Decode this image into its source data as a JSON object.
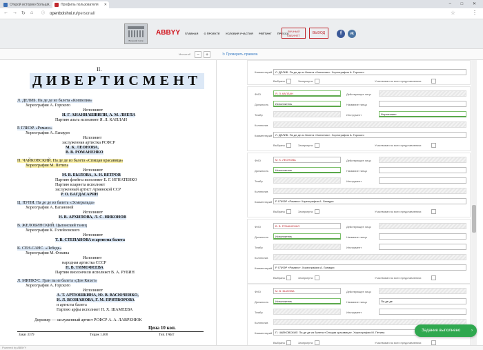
{
  "browser": {
    "tabs": [
      {
        "title": "Открой историю Больш…",
        "favicon_color": "#3b6fb5"
      },
      {
        "title": "Профиль пользователя",
        "favicon_color": "#c0272d"
      }
    ],
    "url_host": "openbolshoi.ru",
    "url_path": "/personal/",
    "window_controls": "–  □  ✕"
  },
  "header": {
    "bolshoi_caption": "Большой театр",
    "abbyy": "ABBYY",
    "nav": [
      "ГЛАВНАЯ",
      "О ПРОЕКТЕ",
      "УСЛОВИЯ УЧАСТИЯ",
      "РЕЙТИНГ",
      "ПРЕССА"
    ],
    "cabinet_line1": "ЛИЧНЫЙ",
    "cabinet_line2": "КАБИНЕТ",
    "exit": "ВЫХОД",
    "fb": "f",
    "vk": "vk"
  },
  "toolbar": {
    "zoom_label": "Масштаб",
    "zoom_out": "−",
    "zoom_in": "+",
    "check_rules": "Проверить правила"
  },
  "scan": {
    "roman": "II.",
    "title": "ДИВЕРТИСМЕНТ",
    "lines": [
      "Л. ДЕЛИБ. Па де де из балета «Коппелия»",
      "Хореография А. Горского",
      "Исполняют",
      "Н. Г. АНАНИАШВИЛИ, А. М. ЛИЕПА",
      "Партию альта исполняет Я. Л. КАПЛАН",
      "Р. ГЛИЭР. «Романс»",
      "Хореография А. Лапаури",
      "Исполняет",
      "заслуженная артистка РСФСР",
      "М. К. ЛЕОНОВА,",
      "В. В. РОМАНЕНКО",
      "П. ЧАЙКОВСКИЙ. Па де де из балета «Спящая красавица»",
      "Хореография М. Петипа",
      "Исполняют",
      "М. В. БЫЛОВА, А. Н. ВЕТРОВ",
      "Партию флейты исполняет Е. Г. ИГНАТЕНКО",
      "Партию кларнета исполняет",
      "заслуженный артист Армянской ССР",
      "Р. О. БАГДАСАРЯН",
      "Ц. ПУНИ. Па де де из балета «Эсмеральда»",
      "Хореография А. Вагановой",
      "Исполняют",
      "Н. В. АРХИПОВА, Л. С. НИКОНОВ",
      "В. ЖЕЛОБИНСКИЙ. Цыганский танец",
      "Хореография К. Голейзовского",
      "Исполняют",
      "Т. В. СТЕПАНОВА и артисты балета",
      "К. СЕН-САНС. «Лебедь»",
      "Хореография М. Фокина",
      "Исполняет",
      "народная артистка СССР",
      "Н. В. ТИМОФЕЕВА",
      "Партию виолончели исполняет В. А. РУБИН",
      "Л. МИНКУС. Гран па из балета «Дон Кихот»",
      "Хореография А. Горского",
      "Исполняют",
      "А. Т. АРТЮШКИНА, Ю. В. ВАСЮЧЕНКО,",
      "И. Л. ВОЗНАНОВА, Г. М. ПРИТВОРОВА",
      "и артисты балета",
      "Партию арфы исполняет Н. Х. ШАМЕЕВА",
      "Дирижер — заслуженный артист РСФСР А. А. ЛАВРЕНЮК",
      "Цена 10 коп.",
      "Заказ 3379",
      "Тираж 1.400",
      "Тип. ГАБТ"
    ]
  },
  "form": {
    "labels": {
      "comment": "Комментарий",
      "chosen": "Выбрана",
      "crossed": "Зачеркнута",
      "in_all": "Участвовал во всех представлениях",
      "fio": "ФИО",
      "actor": "Действующее лицо",
      "role": "Должность",
      "dance": "Название танца",
      "timbre": "Тембр",
      "instrument": "Инструмент",
      "collective": "Коллектив"
    },
    "top_comment": "Л. ДЕЛИБ. Па де де из балета «Коппелия». Хореография А. Горского",
    "blocks": [
      {
        "fio": "Я. Л. КАПЛАН",
        "role": "Исполнитель",
        "instrument": "Фортепиано",
        "dance": "",
        "comment": "Л. ДЕЛИБ. Па де де из балета «Коппелия». Хореография А. Горского"
      },
      {
        "fio": "М. К. ЛЕОНОВА",
        "role": "Исполнитель",
        "instrument": "",
        "dance": "",
        "comment": "Р. ГЛИЭР «Романс» Хореография А. Лапаури"
      },
      {
        "fio": "В. В. РОМАНЕНКО",
        "role": "Исполнитель",
        "instrument": "",
        "dance": "",
        "comment": "Р. ГЛИЭР «Романс». Хореография А. Лапаури"
      },
      {
        "fio": "М. В. БЫЛОВА",
        "role": "Исполнитель",
        "instrument": "",
        "dance": "Па-де-де",
        "comment": "П. ЧАЙКОВСКИЙ. Па де де из балета «Спящая красавица». Хореография М. Петипа"
      }
    ],
    "done_button": "Задание выполнено",
    "done_chevron": "›"
  },
  "status": "Powered by ABBYY",
  "colors": {
    "accent_red": "#c0272d",
    "done_green": "#2fa84f",
    "field_green": "#5aa84a",
    "highlight_blue": "#dce8f6",
    "highlight_yellow": "#fbf1a8"
  }
}
